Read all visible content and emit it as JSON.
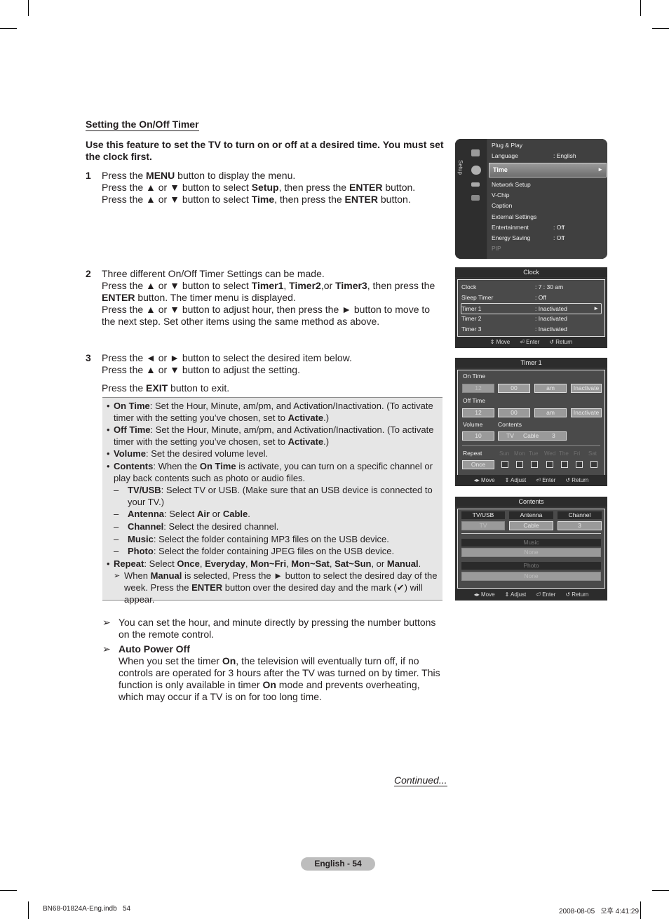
{
  "section_title": "Setting the On/Off Timer",
  "intro": "Use this feature to set the TV to turn on or off at a desired time. You must set the clock first.",
  "steps": [
    {
      "number": "1",
      "lines": [
        [
          "Press the ",
          {
            "b": "MENU"
          },
          " button to display the menu."
        ],
        [
          "Press the ▲ or ▼ button to select ",
          {
            "b": "Setup"
          },
          ", then press the ",
          {
            "b": "ENTER"
          },
          " button."
        ],
        [
          "Press the ▲ or ▼ button to select ",
          {
            "b": "Time"
          },
          ", then press the ",
          {
            "b": "ENTER"
          },
          " button."
        ]
      ]
    },
    {
      "number": "2",
      "lines": [
        [
          "Three different On/Off Timer Settings can be made."
        ],
        [
          "Press the ▲ or ▼ button to select ",
          {
            "b": "Timer1"
          },
          ", ",
          {
            "b": "Timer2"
          },
          ",or ",
          {
            "b": "Timer3"
          },
          ", then press the ",
          {
            "b": "ENTER"
          },
          " button. The timer menu is displayed."
        ],
        [
          "Press the ▲ or ▼ button to adjust hour, then press the ► button to move to the next step. Set other items using the same method as above."
        ]
      ]
    },
    {
      "number": "3",
      "lines": [
        [
          "Press the ◄ or ► button to select the desired item below."
        ],
        [
          "Press the ▲ or ▼ button to adjust the setting."
        ],
        [
          "Press the ",
          {
            "b": "EXIT"
          },
          " button to exit."
        ]
      ]
    }
  ],
  "note_box": [
    {
      "type": "bullet",
      "parts": [
        {
          "b": "On Time"
        },
        ": Set the Hour, Minute, am/pm, and Activation/Inactivation. (To activate timer with the setting you’ve chosen, set to ",
        {
          "b": "Activate"
        },
        ".)"
      ]
    },
    {
      "type": "bullet",
      "parts": [
        {
          "b": "Off Time"
        },
        ": Set the Hour, Minute, am/pm, and Activation/Inactivation. (To activate timer with the setting you’ve chosen, set to ",
        {
          "b": "Activate"
        },
        ".)"
      ]
    },
    {
      "type": "bullet",
      "parts": [
        {
          "b": "Volume"
        },
        ": Set the desired volume level."
      ]
    },
    {
      "type": "bullet",
      "parts": [
        {
          "b": "Contents"
        },
        ": When the ",
        {
          "b": "On Time"
        },
        " is activate, you can turn on a specific channel or play back contents such as photo or audio files."
      ]
    },
    {
      "type": "sub",
      "parts": [
        {
          "b": "TV/USB"
        },
        ": Select TV or USB. (Make sure that an USB device is connected to your TV.)"
      ]
    },
    {
      "type": "sub",
      "parts": [
        {
          "b": "Antenna"
        },
        ": Select ",
        {
          "b": "Air"
        },
        " or ",
        {
          "b": "Cable"
        },
        "."
      ]
    },
    {
      "type": "sub",
      "parts": [
        {
          "b": "Channel"
        },
        ": Select the desired channel."
      ]
    },
    {
      "type": "sub",
      "parts": [
        {
          "b": "Music"
        },
        ": Select the folder containing MP3 files on the USB device."
      ]
    },
    {
      "type": "sub",
      "parts": [
        {
          "b": "Photo"
        },
        ": Select the folder containing JPEG files on the USB device."
      ]
    },
    {
      "type": "bullet",
      "parts": [
        {
          "b": "Repeat"
        },
        ": Select ",
        {
          "b": "Once"
        },
        ", ",
        {
          "b": "Everyday"
        },
        ", ",
        {
          "b": "Mon~Fri"
        },
        ", ",
        {
          "b": "Mon~Sat"
        },
        ", ",
        {
          "b": "Sat~Sun"
        },
        ", or ",
        {
          "b": "Manual"
        },
        "."
      ]
    },
    {
      "type": "note",
      "parts": [
        "When ",
        {
          "b": "Manual"
        },
        " is selected, Press the ► button to select the desired day of the week. Press the ",
        {
          "b": "ENTER"
        },
        " button over the desired day and the mark (✔) will appear."
      ]
    }
  ],
  "notes": [
    {
      "parts": [
        "You can set the hour, and minute directly by pressing the number buttons on the remote control."
      ]
    },
    {
      "parts": [
        {
          "b": "Auto Power Off"
        },
        {
          "br": true
        },
        "When you set the timer ",
        {
          "b": "On"
        },
        ", the television will eventually turn off, if no controls are operated for 3 hours after the TV was turned on by timer. This function is only available in timer ",
        {
          "b": "On"
        },
        " mode and prevents overheating, which may occur if a TV is on for too long time."
      ]
    }
  ],
  "continued": "Continued...",
  "page_label": "English - 54",
  "footer": {
    "left": "BN68-01824A-Eng.indb   54",
    "right": "2008-08-05   오후 4:41:29"
  },
  "setup_menu": {
    "side_label": "Setup",
    "items": [
      {
        "label": "Plug & Play",
        "value": ""
      },
      {
        "label": "Language",
        "value": ": English"
      },
      {
        "label": "Time",
        "value": "",
        "selected": true
      },
      {
        "label": "Network Setup",
        "value": ""
      },
      {
        "label": "V-Chip",
        "value": ""
      },
      {
        "label": "Caption",
        "value": ""
      },
      {
        "label": "External Settings",
        "value": ""
      },
      {
        "label": "Entertainment",
        "value": ": Off"
      },
      {
        "label": "Energy Saving",
        "value": ": Off"
      },
      {
        "label": "PIP",
        "value": "",
        "disabled": true
      }
    ],
    "selected_arrow": "►"
  },
  "clock_menu": {
    "title": "Clock",
    "rows": [
      {
        "label": "Clock",
        "value": ": 7 : 30 am"
      },
      {
        "label": "Sleep Timer",
        "value": ": Off"
      },
      {
        "label": "Timer 1",
        "value": ": Inactivated",
        "highlighted": true
      },
      {
        "label": "Timer 2",
        "value": ": Inactivated"
      },
      {
        "label": "Timer 3",
        "value": ": Inactivated"
      }
    ],
    "footer": [
      "⇕ Move",
      "⏎ Enter",
      "↺ Return"
    ]
  },
  "timer_menu": {
    "title": "Timer 1",
    "on_time_label": "On Time",
    "on_time": {
      "hour": "12",
      "minute": "00",
      "ampm": "am",
      "activation": "Inactivate"
    },
    "off_time_label": "Off Time",
    "off_time": {
      "hour": "12",
      "minute": "00",
      "ampm": "am",
      "activation": "Inactivate"
    },
    "volume_label": "Volume",
    "volume_value": "10",
    "contents_label": "Contents",
    "contents_source": "TV",
    "contents_antenna": "Cable",
    "contents_channel": "3",
    "repeat_label": "Repeat",
    "repeat_value": "Once",
    "days": [
      "Sun",
      "Mon",
      "Tue",
      "Wed",
      "The",
      "Fri",
      "Sat"
    ],
    "footer": [
      "◂▸ Move",
      "⇕ Adjust",
      "⏎ Enter",
      "↺ Return"
    ]
  },
  "contents_menu": {
    "title": "Contents",
    "col_headers": [
      "TV/USB",
      "Antenna",
      "Channel"
    ],
    "col_values": [
      "TV",
      "Cable",
      "3"
    ],
    "music_label": "Music",
    "music_value": "None",
    "photo_label": "Photo",
    "photo_value": "None",
    "footer": [
      "◂▸ Move",
      "⇕ Adjust",
      "⏎ Enter",
      "↺ Return"
    ]
  }
}
